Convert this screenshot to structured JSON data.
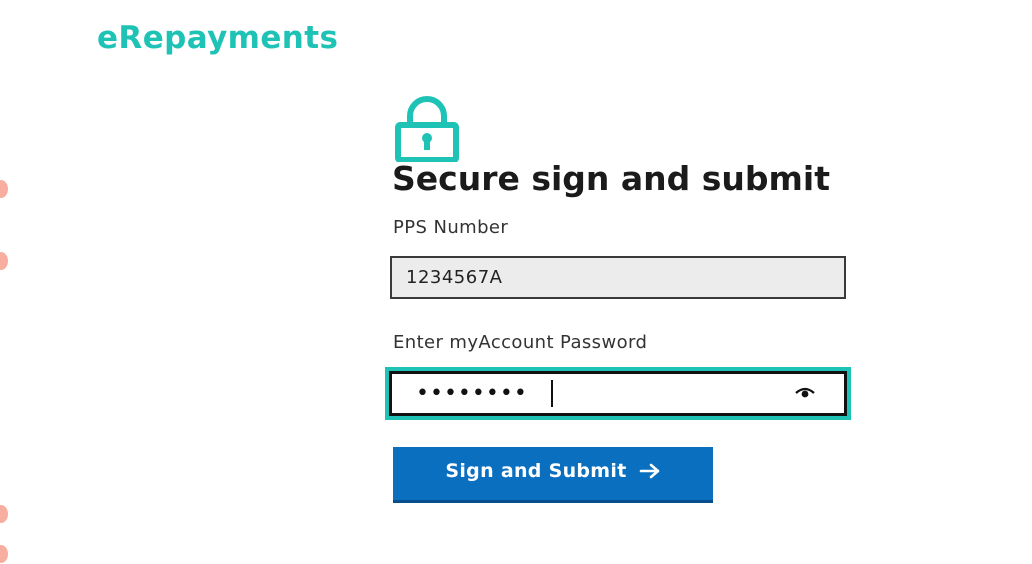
{
  "brand": {
    "name": "eRepayments"
  },
  "form": {
    "title": "Secure sign and submit",
    "pps_label": "PPS Number",
    "pps_value": "1234567A",
    "password_label": "Enter myAccount Password",
    "password_value": "secretpw",
    "submit_label": "Sign and Submit",
    "icons": {
      "header": "lock-icon",
      "toggle": "eye-icon",
      "submit": "arrow-right-icon"
    }
  },
  "colors": {
    "brand": "#1fc3b6",
    "focus_ring": "#1fc3b6",
    "primary_button": "#0b6fc0",
    "text": "#1b1b1b"
  }
}
